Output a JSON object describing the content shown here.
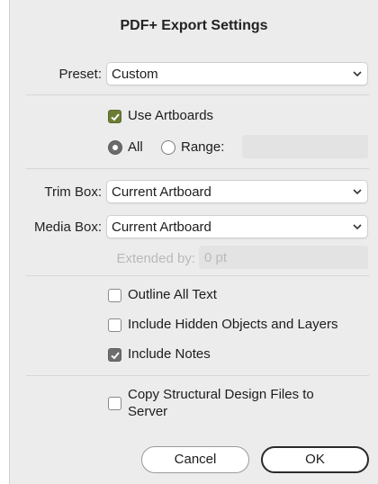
{
  "dialog": {
    "title": "PDF+ Export Settings"
  },
  "preset": {
    "label": "Preset:",
    "value": "Custom"
  },
  "artboards": {
    "use_artboards_label": "Use Artboards",
    "use_artboards_checked": true,
    "all_label": "All",
    "range_label": "Range:",
    "selected": "All",
    "range_value": ""
  },
  "trim_box": {
    "label": "Trim Box:",
    "value": "Current Artboard"
  },
  "media_box": {
    "label": "Media Box:",
    "value": "Current Artboard"
  },
  "extended_by": {
    "label": "Extended by:",
    "value": "0 pt"
  },
  "options": [
    {
      "label": "Outline All Text",
      "checked": false
    },
    {
      "label": "Include Hidden Objects and Layers",
      "checked": false
    },
    {
      "label": "Include Notes",
      "checked": true
    }
  ],
  "copy_structural": {
    "label_line1": "Copy Structural Design Files to",
    "label_line2": "Server",
    "checked": false
  },
  "buttons": {
    "cancel": "Cancel",
    "ok": "OK"
  },
  "colors": {
    "accent_check": "#6b7d33",
    "dialog_bg": "#ececec"
  }
}
